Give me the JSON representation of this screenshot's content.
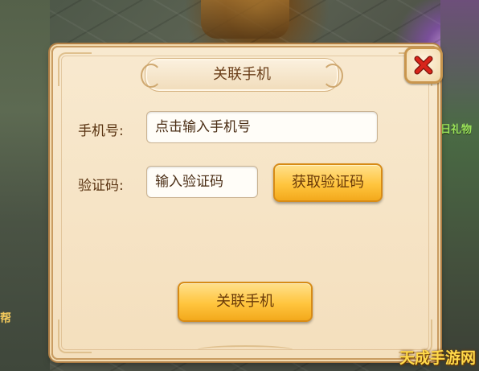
{
  "dialog": {
    "title": "关联手机",
    "phone_label": "手机号:",
    "phone_placeholder": "点击输入手机号",
    "code_label": "验证码:",
    "code_placeholder": "输入验证码",
    "get_code_button": "获取验证码",
    "confirm_button": "关联手机",
    "close_icon": "close-icon"
  },
  "background": {
    "right_side_text": "日礼物",
    "left_side_text": "帮"
  },
  "watermark": "天成手游网",
  "colors": {
    "panel_bg": "#f6e4c6",
    "panel_border": "#c99c62",
    "button_gold": "#ffc53e",
    "close_red": "#d8251b",
    "text_brown": "#5a3412"
  }
}
